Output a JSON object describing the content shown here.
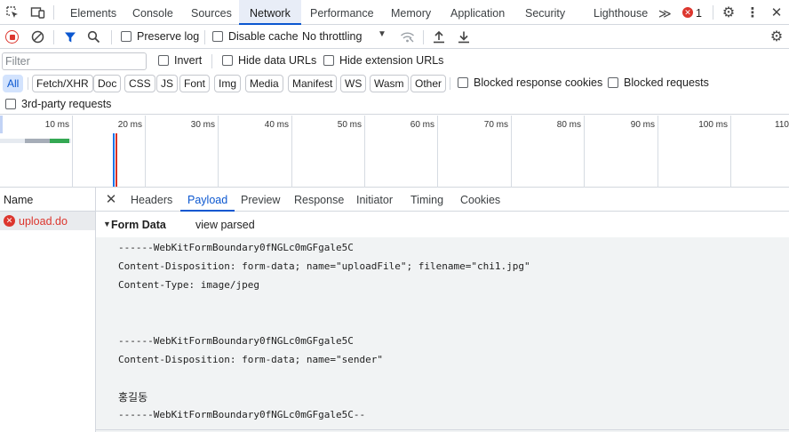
{
  "top_tabs": [
    "Elements",
    "Console",
    "Sources",
    "Network",
    "Performance",
    "Memory",
    "Application",
    "Security",
    "Lighthouse"
  ],
  "active_tab": "Network",
  "more_tabs_glyph": "≫",
  "error_count": "1",
  "toolbar": {
    "preserve_log": "Preserve log",
    "disable_cache": "Disable cache",
    "throttling": "No throttling"
  },
  "filter": {
    "placeholder": "Filter",
    "invert": "Invert",
    "hide_data_urls": "Hide data URLs",
    "hide_extension_urls": "Hide extension URLs"
  },
  "type_filters": [
    "All",
    "Fetch/XHR",
    "Doc",
    "CSS",
    "JS",
    "Font",
    "Img",
    "Media",
    "Manifest",
    "WS",
    "Wasm",
    "Other"
  ],
  "blocked_response_cookies": "Blocked response cookies",
  "blocked_requests": "Blocked requests",
  "third_party": "3rd-party requests",
  "timeline_ticks": [
    "10 ms",
    "20 ms",
    "30 ms",
    "40 ms",
    "50 ms",
    "60 ms",
    "70 ms",
    "80 ms",
    "90 ms",
    "100 ms",
    "110"
  ],
  "request_list": {
    "header": "Name",
    "items": [
      {
        "name": "upload.do",
        "status": "error"
      }
    ]
  },
  "detail_tabs": [
    "Headers",
    "Payload",
    "Preview",
    "Response",
    "Initiator",
    "Timing",
    "Cookies"
  ],
  "active_detail_tab": "Payload",
  "form_data": {
    "title": "Form Data",
    "view_toggle": "view parsed",
    "lines": [
      "------WebKitFormBoundary0fNGLc0mGFgale5C",
      "Content-Disposition: form-data; name=\"uploadFile\"; filename=\"chi1.jpg\"",
      "Content-Type: image/jpeg",
      "",
      "",
      "",
      "------WebKitFormBoundary0fNGLc0mGFgale5C",
      "Content-Disposition: form-data; name=\"sender\"",
      "",
      "홍길동",
      "------WebKitFormBoundary0fNGLc0mGFgale5C--"
    ]
  },
  "colors": {
    "accent": "#0b57d0",
    "error": "#dc362e",
    "active_chip_bg": "#d3e3fd",
    "payload_bg": "#f1f3f4"
  }
}
